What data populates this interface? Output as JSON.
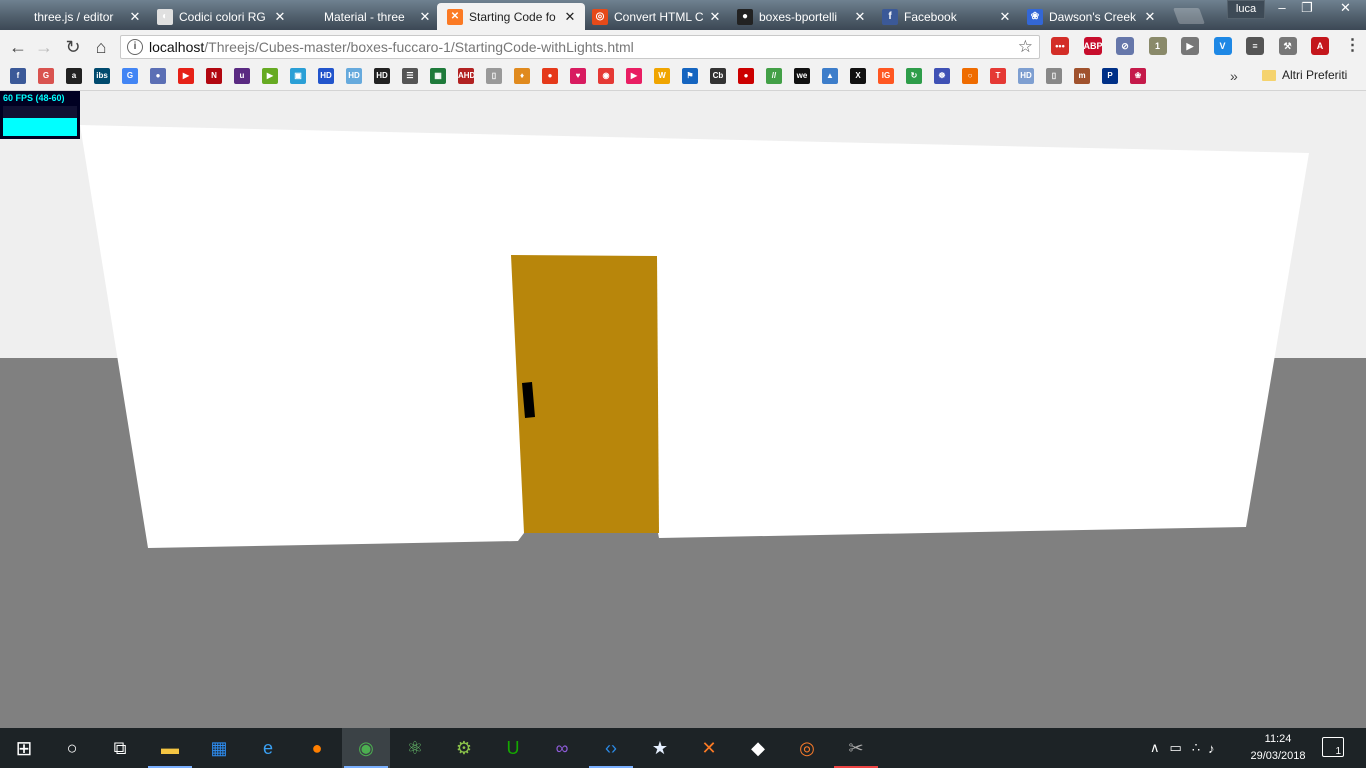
{
  "tabs": [
    {
      "title": "three.js / editor",
      "favicon": "threejs-icon",
      "active": false
    },
    {
      "title": "Codici colori RG",
      "favicon": "color-wheel-icon",
      "active": false
    },
    {
      "title": "Material - three",
      "favicon": "threejs-icon",
      "active": false
    },
    {
      "title": "Starting Code fo",
      "favicon": "xampp-icon",
      "active": true
    },
    {
      "title": "Convert HTML C",
      "favicon": "convert-icon",
      "active": false
    },
    {
      "title": "boxes-bportelli",
      "favicon": "github-icon",
      "active": false
    },
    {
      "title": "Facebook",
      "favicon": "facebook-icon",
      "active": false
    },
    {
      "title": "Dawson's Creek",
      "favicon": "paw-icon",
      "active": false
    }
  ],
  "window": {
    "profile": "luca",
    "minimize": "–",
    "restore": "❐",
    "close": "✕"
  },
  "toolbar": {
    "back": "←",
    "forward": "→",
    "reload": "↻",
    "home": "⌂",
    "url_host": "localhost",
    "url_path": "/Threejs/Cubes-master/boxes-fuccaro-1/StartingCode-withLights.html",
    "star": "☆",
    "info": "i"
  },
  "extensions": [
    {
      "name": "lastpass-icon",
      "text": "•••",
      "color": "#d32d27"
    },
    {
      "name": "adblock-plus-icon",
      "text": "ABP",
      "color": "#c70d2c"
    },
    {
      "name": "block-icon",
      "text": "⊘",
      "color": "#6677aa"
    },
    {
      "name": "puzzle-extension-icon",
      "text": "1",
      "color": "#8a8a6a"
    },
    {
      "name": "youtube-ext-icon",
      "text": "▶",
      "color": "#777777"
    },
    {
      "name": "vpn-shield-icon",
      "text": "V",
      "color": "#1e88e5"
    },
    {
      "name": "library-icon",
      "text": "≡",
      "color": "#555555"
    },
    {
      "name": "wrench-icon",
      "text": "⚒",
      "color": "#777777"
    },
    {
      "name": "pdf-icon",
      "text": "A",
      "color": "#c4161c"
    },
    {
      "name": "chrome-menu-icon",
      "text": "⋮",
      "color": "#f2f2f2"
    }
  ],
  "bookmarks": {
    "icons": [
      {
        "name": "facebook-icon",
        "text": "f",
        "color": "#3b5998"
      },
      {
        "name": "g-bookmark-icon",
        "text": "G",
        "color": "#d9534f"
      },
      {
        "name": "amazon-icon",
        "text": "a",
        "color": "#222222"
      },
      {
        "name": "ibs-icon",
        "text": "ibs",
        "color": "#004a6e"
      },
      {
        "name": "translate-icon",
        "text": "G",
        "color": "#4285f4"
      },
      {
        "name": "chrome-bookmark-icon",
        "text": "●",
        "color": "#5b6fb5"
      },
      {
        "name": "youtube-icon",
        "text": "▶",
        "color": "#e62117"
      },
      {
        "name": "netflix-icon",
        "text": "N",
        "color": "#b20710"
      },
      {
        "name": "unity-bookmark-icon",
        "text": "u",
        "color": "#5a2a82"
      },
      {
        "name": "play-bookmark-icon",
        "text": "▶",
        "color": "#66aa22"
      },
      {
        "name": "tv-icon",
        "text": "▣",
        "color": "#2a9fd6"
      },
      {
        "name": "hd-blue-icon",
        "text": "HD",
        "color": "#2255cc"
      },
      {
        "name": "hd-light-icon",
        "text": "HD",
        "color": "#66aadd"
      },
      {
        "name": "hd-dark-icon",
        "text": "HD",
        "color": "#222222"
      },
      {
        "name": "clipboard-icon",
        "text": "☰",
        "color": "#555555"
      },
      {
        "name": "sheet-icon",
        "text": "▦",
        "color": "#1e7a3a"
      },
      {
        "name": "ahd-icon",
        "text": "AHD",
        "color": "#b22222"
      },
      {
        "name": "page-icon",
        "text": "▯",
        "color": "#999999"
      },
      {
        "name": "emblem-icon",
        "text": "♦",
        "color": "#e08a1e"
      },
      {
        "name": "tomato-icon",
        "text": "●",
        "color": "#e5391a"
      },
      {
        "name": "heart-badge-icon",
        "text": "♥",
        "color": "#d81b60"
      },
      {
        "name": "red-circle-icon",
        "text": "◉",
        "color": "#e53935"
      },
      {
        "name": "arrow-red-icon",
        "text": "▶",
        "color": "#e91e63"
      },
      {
        "name": "w-icon",
        "text": "W",
        "color": "#f0a500"
      },
      {
        "name": "person-icon",
        "text": "⚑",
        "color": "#1565c0"
      },
      {
        "name": "cb-icon",
        "text": "Cb",
        "color": "#333333"
      },
      {
        "name": "record-icon",
        "text": "●",
        "color": "#cc0000"
      },
      {
        "name": "green-slash-icon",
        "text": "//",
        "color": "#43a047"
      },
      {
        "name": "we-icon",
        "text": "we",
        "color": "#111111"
      },
      {
        "name": "drop-icon",
        "text": "▲",
        "color": "#3d7dca"
      },
      {
        "name": "x-icon",
        "text": "X",
        "color": "#111111"
      },
      {
        "name": "ig-icon",
        "text": "IG",
        "color": "#ff5722"
      },
      {
        "name": "refresh-green-icon",
        "text": "↻",
        "color": "#2e9d4a"
      },
      {
        "name": "film-icon",
        "text": "☸",
        "color": "#3f51b5"
      },
      {
        "name": "ring-icon",
        "text": "○",
        "color": "#ef6c00"
      },
      {
        "name": "t-icon",
        "text": "T",
        "color": "#e53935"
      },
      {
        "name": "hd-small-icon",
        "text": "HD",
        "color": "#7e9fd1"
      },
      {
        "name": "doc-icon",
        "text": "▯",
        "color": "#888888"
      },
      {
        "name": "mm-icon",
        "text": "m",
        "color": "#a0522d"
      },
      {
        "name": "paypal-icon",
        "text": "P",
        "color": "#003087"
      },
      {
        "name": "raspberry-icon",
        "text": "❀",
        "color": "#c51a4a"
      }
    ],
    "more": "»",
    "other": "Altri Preferiti"
  },
  "stats": {
    "text": "60 FPS (48-60)",
    "fill": 0.6,
    "bg": "#000022",
    "fg": "#00ffff"
  },
  "scene": {
    "background": "#efefef",
    "floor": "#808080",
    "wall": "#ffffff",
    "door": "#b8860b",
    "handle": "#000000"
  },
  "taskbar": {
    "apps": [
      {
        "name": "start-icon",
        "text": "⊞",
        "active": false
      },
      {
        "name": "cortana-icon",
        "text": "○",
        "active": false
      },
      {
        "name": "task-view-icon",
        "text": "⧉",
        "active": false
      },
      {
        "name": "file-explorer-icon",
        "text": "▬",
        "active": false
      },
      {
        "name": "store-icon",
        "text": "▦",
        "active": false
      },
      {
        "name": "edge-icon",
        "text": "e",
        "active": false
      },
      {
        "name": "firefox-icon",
        "text": "●",
        "active": false
      },
      {
        "name": "chrome-icon",
        "text": "◉",
        "active": true
      },
      {
        "name": "atom-icon",
        "text": "⚛",
        "active": false
      },
      {
        "name": "android-studio-icon",
        "text": "⚙",
        "active": false
      },
      {
        "name": "upwork-icon",
        "text": "U",
        "active": false
      },
      {
        "name": "visual-studio-icon",
        "text": "∞",
        "active": false
      },
      {
        "name": "vscode-icon",
        "text": "‹›",
        "active": false
      },
      {
        "name": "maya-icon",
        "text": "★",
        "active": false
      },
      {
        "name": "xampp-icon",
        "text": "✕",
        "active": false
      },
      {
        "name": "unity-icon",
        "text": "◆",
        "active": false
      },
      {
        "name": "blender-icon",
        "text": "◎",
        "active": false
      },
      {
        "name": "snipping-icon",
        "text": "✂",
        "active": false
      }
    ],
    "tray": {
      "chevron": "∧",
      "battery": "▭",
      "wifi": "∴",
      "volume": "♪"
    },
    "time": "11:24",
    "date": "29/03/2018",
    "notifications": "1"
  }
}
